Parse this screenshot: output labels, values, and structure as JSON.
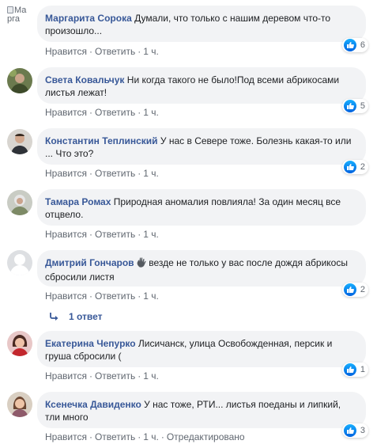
{
  "actions": {
    "like": "Нравится",
    "reply": "Ответить",
    "sep": "·"
  },
  "colors": {
    "author": "#385898",
    "bubble": "#f2f3f5",
    "meta": "#606770",
    "like_badge": "#1877f2"
  },
  "comments": [
    {
      "author": "Маргарита Сорока",
      "text": "Думали, что только с нашим деревом что-то произошло...",
      "likes": "6",
      "time": "1 ч.",
      "avatar_alt": "Ма\nрга"
    },
    {
      "author": "Света Ковальчук",
      "text": "Ни когда такого не было!Под всеми абрикосами листья лежат!",
      "likes": "5",
      "time": "1 ч."
    },
    {
      "author": "Константин Теплинский",
      "text": "У нас в Севере тоже. Болезнь какая-то или ... Что это?",
      "likes": "2",
      "time": "1 ч."
    },
    {
      "author": "Тамара Ромах",
      "text": "Природная аномалия повлияла! За один месяц все отцвело.",
      "likes": "",
      "time": "1 ч."
    },
    {
      "author": "Дмитрий Гончаров",
      "text": "везде не только у вас после дождя абрикосы сбросили листя",
      "likes": "2",
      "time": "1 ч.",
      "emoji_icon": "hand-wave-icon"
    },
    {
      "author": "Екатерина Чепурко",
      "text": "Лисичанск, улица Освобожденная, персик и груша сбросили (",
      "likes": "1",
      "time": "1 ч."
    },
    {
      "author": "Ксенечка Давиденко",
      "text": "У нас тоже, РТИ... листья поеданы и липкий, тли много",
      "likes": "3",
      "time": "1 ч.",
      "edited": "Отредактировано"
    }
  ],
  "replies_link": "1 ответ"
}
